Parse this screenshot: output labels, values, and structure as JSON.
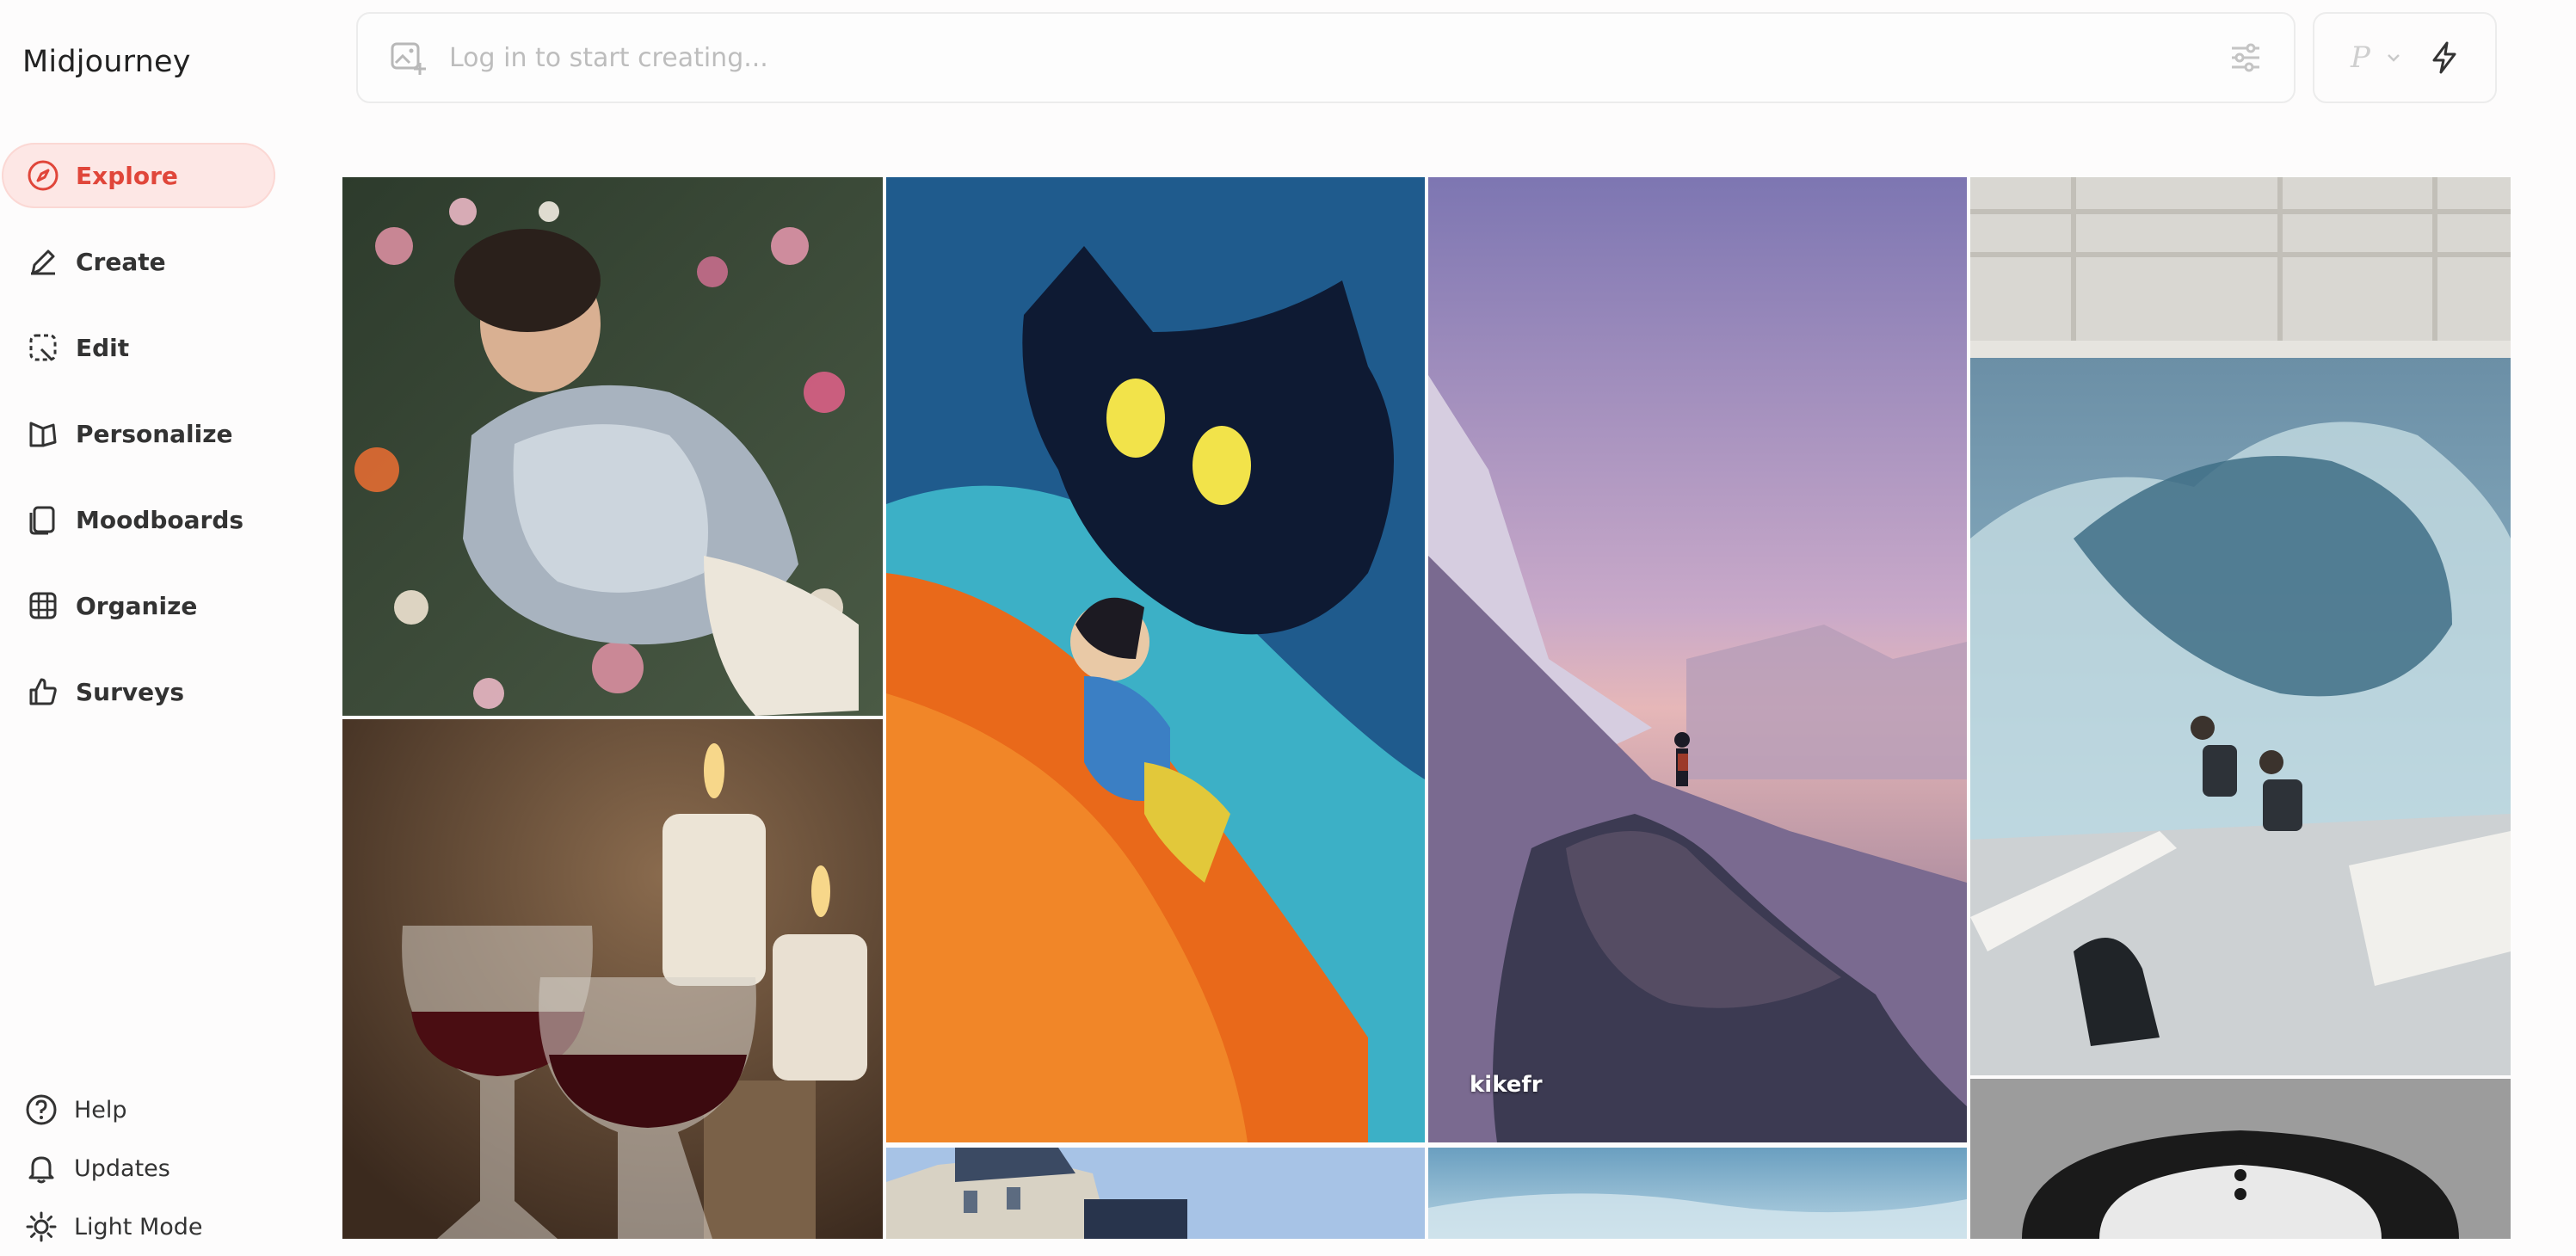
{
  "app": {
    "name": "Midjourney"
  },
  "nav": {
    "items": [
      {
        "label": "Explore",
        "icon": "compass-icon",
        "active": true
      },
      {
        "label": "Create",
        "icon": "brush-icon"
      },
      {
        "label": "Edit",
        "icon": "edit-icon"
      },
      {
        "label": "Personalize",
        "icon": "personalize-icon"
      },
      {
        "label": "Moodboards",
        "icon": "moodboard-icon"
      },
      {
        "label": "Organize",
        "icon": "grid-icon"
      },
      {
        "label": "Surveys",
        "icon": "thumbs-up-icon"
      }
    ],
    "bottom": [
      {
        "label": "Help",
        "icon": "help-icon"
      },
      {
        "label": "Updates",
        "icon": "bell-icon"
      },
      {
        "label": "Light Mode",
        "icon": "sun-icon"
      }
    ]
  },
  "prompt": {
    "placeholder": "Log in to start creating..."
  },
  "model": {
    "letter": "P"
  },
  "gallery": {
    "captions": {
      "mountain": "kikefr"
    }
  },
  "colors": {
    "accent": "#e0463a",
    "active_bg": "#fde7e5"
  }
}
